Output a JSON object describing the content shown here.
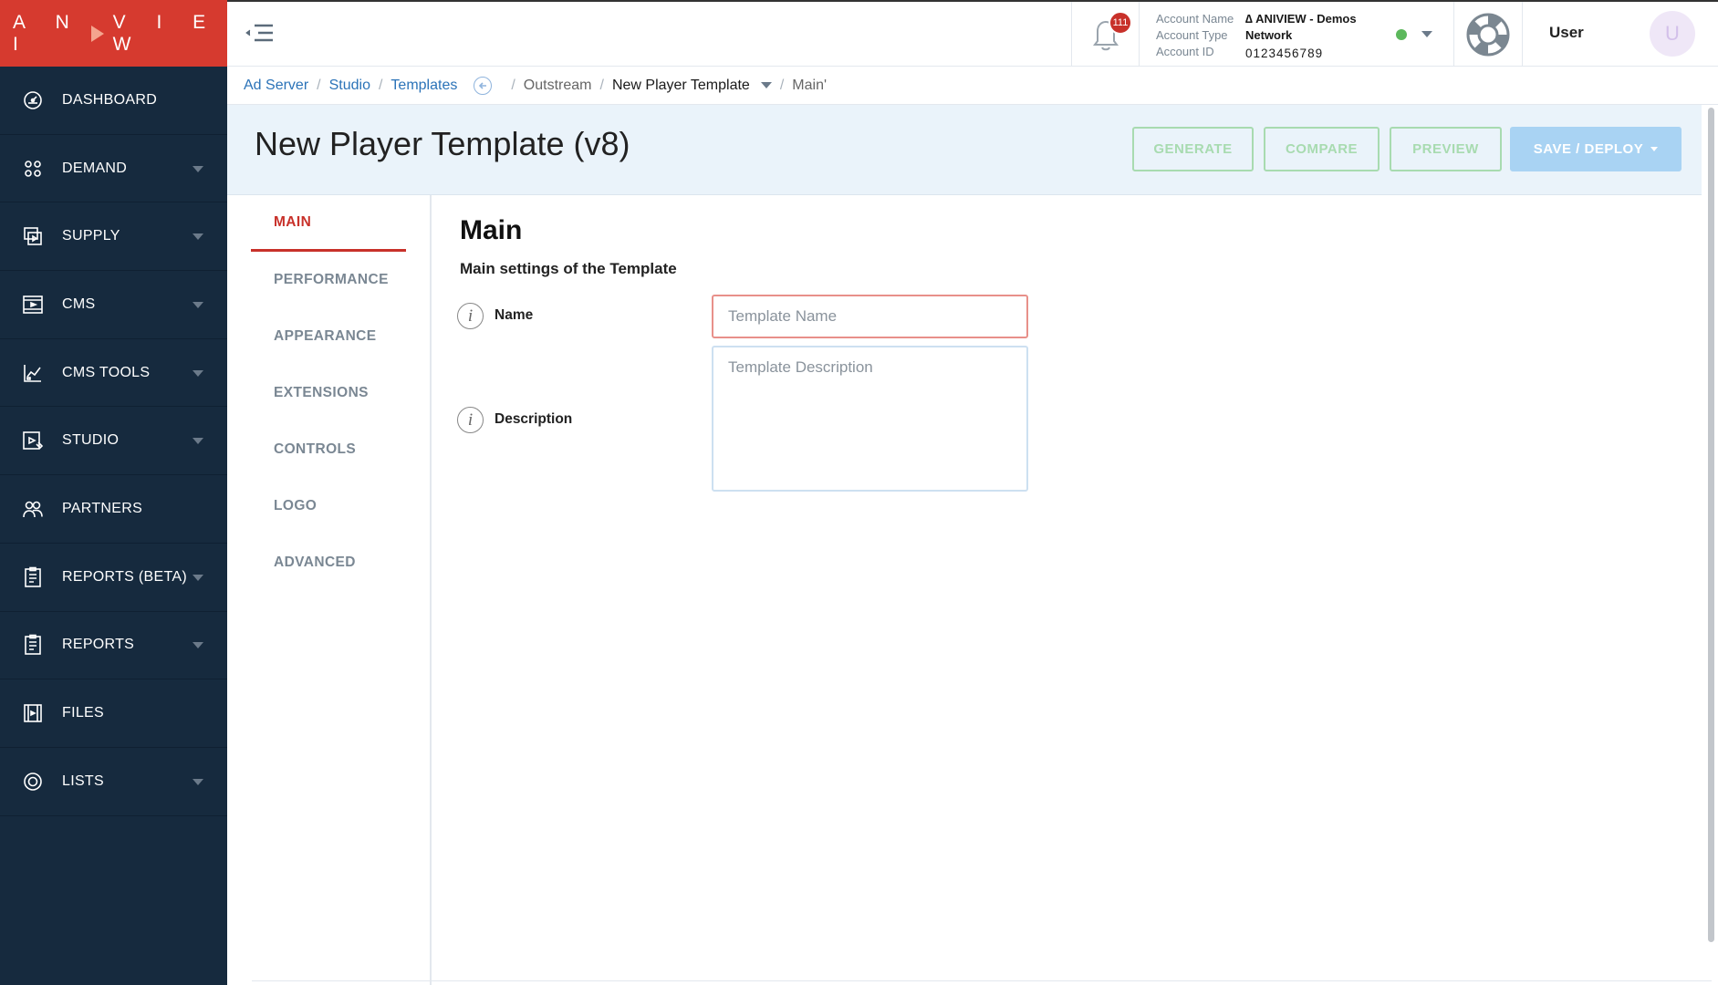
{
  "app": {
    "logo_text": "ANIVIEW",
    "logo_left": "A N I",
    "logo_right": "V I E W"
  },
  "sidebar": {
    "items": [
      {
        "label": "DASHBOARD",
        "icon": "dashboard-icon",
        "has_caret": false
      },
      {
        "label": "DEMAND",
        "icon": "demand-icon",
        "has_caret": true
      },
      {
        "label": "SUPPLY",
        "icon": "supply-icon",
        "has_caret": true
      },
      {
        "label": "CMS",
        "icon": "cms-icon",
        "has_caret": true
      },
      {
        "label": "CMS TOOLS",
        "icon": "cms-tools-icon",
        "has_caret": true
      },
      {
        "label": "STUDIO",
        "icon": "studio-icon",
        "has_caret": true
      },
      {
        "label": "PARTNERS",
        "icon": "partners-icon",
        "has_caret": false
      },
      {
        "label": "REPORTS (BETA)",
        "icon": "reports-beta-icon",
        "has_caret": true
      },
      {
        "label": "REPORTS",
        "icon": "reports-icon",
        "has_caret": true
      },
      {
        "label": "FILES",
        "icon": "files-icon",
        "has_caret": false
      },
      {
        "label": "LISTS",
        "icon": "lists-icon",
        "has_caret": true
      }
    ]
  },
  "topbar": {
    "notification_count": "111",
    "account": {
      "name_label": "Account Name",
      "name_value": "∆ ANIVIEW - Demos",
      "type_label": "Account Type",
      "type_value": "Network",
      "id_label": "Account ID",
      "id_value": "0123456789"
    },
    "status_color": "#5cb85c",
    "user_label": "User",
    "avatar_initial": "U"
  },
  "breadcrumb": {
    "ad_server": "Ad Server",
    "studio": "Studio",
    "templates": "Templates",
    "outstream": "Outstream",
    "template": "New Player Template",
    "section": "Main'"
  },
  "header": {
    "title": "New Player Template (v8)",
    "generate": "GENERATE",
    "compare": "COMPARE",
    "preview": "PREVIEW",
    "deploy": "SAVE / DEPLOY"
  },
  "tabs": [
    "MAIN",
    "PERFORMANCE",
    "APPEARANCE",
    "EXTENSIONS",
    "CONTROLS",
    "LOGO",
    "ADVANCED"
  ],
  "main": {
    "title": "Main",
    "subtitle": "Main settings of the Template",
    "name_label": "Name",
    "name_placeholder": "Template Name",
    "desc_label": "Description",
    "desc_placeholder": "Template Description"
  },
  "colors": {
    "brand_red": "#d63a2f",
    "sidebar_bg": "#162a3e",
    "accent_green": "#a8dbb0",
    "deploy_blue": "#a9d3f3"
  }
}
